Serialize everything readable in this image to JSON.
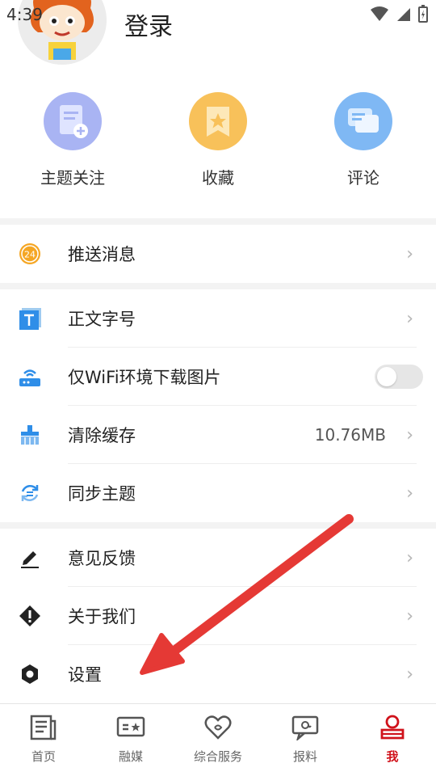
{
  "status_bar": {
    "time": "4:39"
  },
  "header": {
    "login_label": "登录"
  },
  "quick_actions": [
    {
      "label": "主题关注",
      "icon": "document-add-icon",
      "color": "#a9b4f3"
    },
    {
      "label": "收藏",
      "icon": "bookmark-star-icon",
      "color": "#f8c15a"
    },
    {
      "label": "评论",
      "icon": "chat-bubbles-icon",
      "color": "#7fb8f4"
    }
  ],
  "menu": {
    "push": {
      "label": "推送消息",
      "badge": "24"
    },
    "font_size": {
      "label": "正文字号"
    },
    "wifi_images": {
      "label": "仅WiFi环境下载图片",
      "enabled": false
    },
    "clear_cache": {
      "label": "清除缓存",
      "value": "10.76MB"
    },
    "sync_theme": {
      "label": "同步主题"
    },
    "feedback": {
      "label": "意见反馈"
    },
    "about": {
      "label": "关于我们"
    },
    "settings": {
      "label": "设置"
    }
  },
  "bottom_nav": [
    {
      "label": "首页",
      "icon": "newspaper-icon"
    },
    {
      "label": "融媒",
      "icon": "media-card-icon"
    },
    {
      "label": "综合服务",
      "icon": "heart-service-icon"
    },
    {
      "label": "报料",
      "icon": "report-tip-icon"
    },
    {
      "label": "我",
      "icon": "person-icon",
      "active": true
    }
  ],
  "colors": {
    "accent": "#d0121b",
    "annotation_arrow": "#e53935"
  }
}
